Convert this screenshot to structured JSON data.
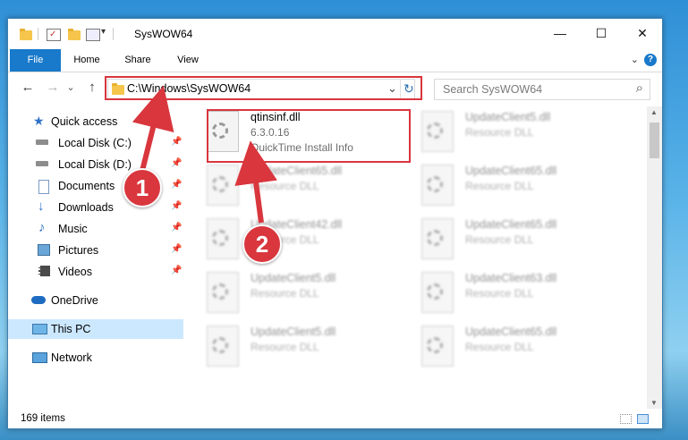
{
  "window": {
    "title": "SysWOW64",
    "minimize": "—",
    "maximize": "☐",
    "close": "✕"
  },
  "ribbon": {
    "tabs": [
      "File",
      "Home",
      "Share",
      "View"
    ],
    "help": "?"
  },
  "nav": {
    "back": "←",
    "forward": "→",
    "recent": "⌄",
    "up": "↑",
    "address": "C:\\Windows\\SysWOW64",
    "address_dropdown": "⌄",
    "refresh": "↻",
    "search_placeholder": "Search SysWOW64",
    "search_icon": "⌕"
  },
  "sidebar": {
    "items": [
      {
        "label": "Quick access",
        "icon": "star-icon",
        "pinned": false
      },
      {
        "label": "Local Disk (C:)",
        "icon": "drive-icon",
        "pinned": true
      },
      {
        "label": "Local Disk (D:)",
        "icon": "drive-icon",
        "pinned": true
      },
      {
        "label": "Documents",
        "icon": "documents-icon",
        "pinned": true
      },
      {
        "label": "Downloads",
        "icon": "download-icon",
        "pinned": true
      },
      {
        "label": "Music",
        "icon": "music-icon",
        "pinned": true
      },
      {
        "label": "Pictures",
        "icon": "pictures-icon",
        "pinned": true
      },
      {
        "label": "Videos",
        "icon": "videos-icon",
        "pinned": true
      },
      {
        "label": "OneDrive",
        "icon": "cloud-icon",
        "pinned": false
      },
      {
        "label": "This PC",
        "icon": "computer-icon",
        "pinned": false,
        "selected": true
      },
      {
        "label": "Network",
        "icon": "network-icon",
        "pinned": false
      }
    ]
  },
  "files": [
    {
      "name": "qtinsinf.dll",
      "version": "6.3.0.16",
      "description": "QuickTime Install Info",
      "highlighted": true
    },
    {
      "name": "UpdateClient5.dll",
      "description": "Resource DLL",
      "blurred": true
    },
    {
      "name": "UpdateClient65.dll",
      "description": "Resource DLL",
      "blurred": true
    },
    {
      "name": "UpdateClient65.dll",
      "description": "Resource DLL",
      "blurred": true
    },
    {
      "name": "UpdateClient42.dll",
      "description": "Resource DLL",
      "blurred": true
    },
    {
      "name": "UpdateClient65.dll",
      "description": "Resource DLL",
      "blurred": true
    },
    {
      "name": "UpdateClient5.dll",
      "description": "Resource DLL",
      "blurred": true
    },
    {
      "name": "UpdateClient63.dll",
      "description": "Resource DLL",
      "blurred": true
    },
    {
      "name": "UpdateClient5.dll",
      "description": "Resource DLL",
      "blurred": true
    },
    {
      "name": "UpdateClient65.dll",
      "description": "Resource DLL",
      "blurred": true
    }
  ],
  "status": {
    "item_count": "169 items"
  },
  "annotations": {
    "badge1": "1",
    "badge2": "2",
    "color": "#d9363e"
  },
  "pin_glyph": "📌"
}
